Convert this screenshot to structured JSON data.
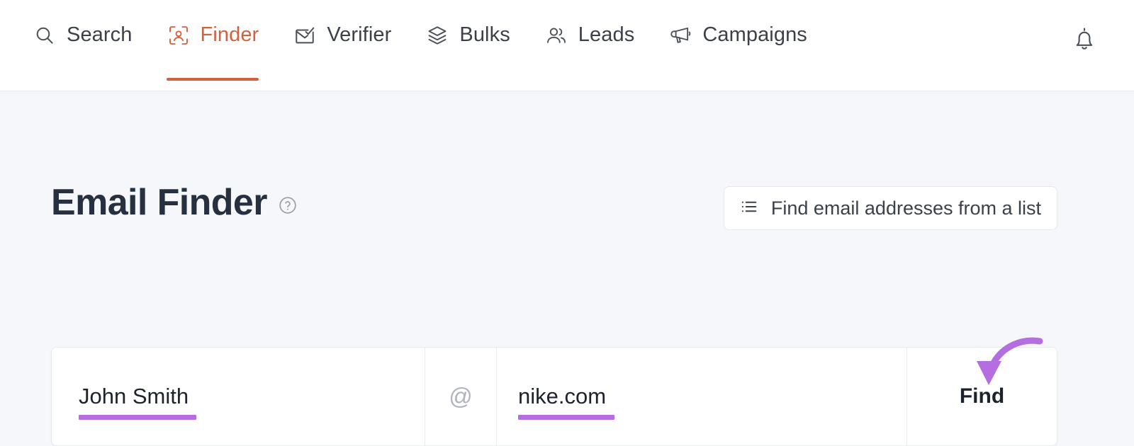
{
  "header": {
    "nav_items": [
      {
        "label": "Search",
        "icon": "search-icon",
        "active": false
      },
      {
        "label": "Finder",
        "icon": "person-scan-icon",
        "active": true
      },
      {
        "label": "Verifier",
        "icon": "envelope-check-icon",
        "active": false
      },
      {
        "label": "Bulks",
        "icon": "layers-icon",
        "active": false
      },
      {
        "label": "Leads",
        "icon": "users-icon",
        "active": false
      },
      {
        "label": "Campaigns",
        "icon": "megaphone-icon",
        "active": false
      }
    ],
    "notification_icon": "bell-icon",
    "active_color": "#d4603c"
  },
  "main": {
    "page_title": "Email Finder",
    "help_icon": "question-circle-icon",
    "list_button": {
      "label": "Find email addresses from a list",
      "icon": "bulleted-list-icon"
    },
    "finder": {
      "name_value": "John Smith",
      "name_placeholder": "John Smith",
      "at_symbol": "@",
      "domain_value": "nike.com",
      "domain_placeholder": "nike.com",
      "find_label": "Find"
    },
    "annotations": {
      "highlight_color": "#b46ee0",
      "arrow_icon": "curved-arrow-down-icon",
      "arrow_target": "Find"
    }
  }
}
